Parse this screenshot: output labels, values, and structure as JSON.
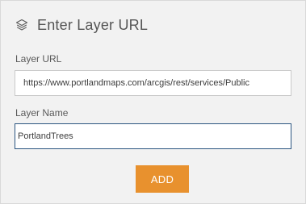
{
  "header": {
    "icon": "layers-icon",
    "title": "Enter Layer URL"
  },
  "form": {
    "layer_url_label": "Layer URL",
    "layer_url_value": "https://www.portlandmaps.com/arcgis/rest/services/Public",
    "layer_name_label": "Layer Name",
    "layer_name_value": "PortlandTrees"
  },
  "actions": {
    "add_label": "ADD"
  },
  "colors": {
    "accent": "#e8912e",
    "focus_border": "#2b5580",
    "background": "#f2f2f2"
  }
}
